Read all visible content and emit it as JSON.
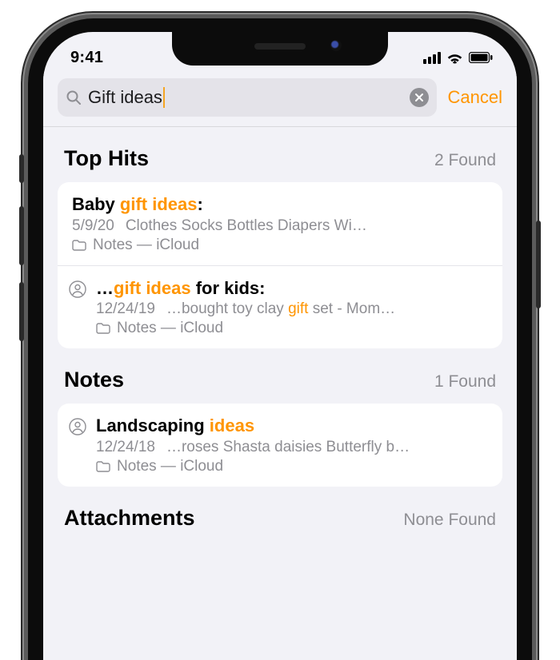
{
  "status": {
    "time": "9:41"
  },
  "search": {
    "query": "Gift ideas",
    "cancel_label": "Cancel"
  },
  "sections": {
    "top_hits": {
      "title": "Top Hits",
      "count": "2 Found",
      "results": [
        {
          "title_pre": "Baby ",
          "title_hl": "gift ideas",
          "title_post": ":",
          "date": "5/9/20",
          "snippet_pre": "Clothes Socks Bottles Diapers Wi…",
          "snippet_hl": "",
          "snippet_post": "",
          "location": "Notes — iCloud",
          "shared": false
        },
        {
          "title_pre": "…",
          "title_hl": "gift ideas",
          "title_post": " for kids:",
          "date": "12/24/19",
          "snippet_pre": "…bought toy clay ",
          "snippet_hl": "gift",
          "snippet_post": " set - Mom…",
          "location": "Notes — iCloud",
          "shared": true
        }
      ]
    },
    "notes": {
      "title": "Notes",
      "count": "1 Found",
      "results": [
        {
          "title_pre": "Landscaping ",
          "title_hl": "ideas",
          "title_post": "",
          "date": "12/24/18",
          "snippet_pre": "…roses Shasta daisies Butterfly b…",
          "snippet_hl": "",
          "snippet_post": "",
          "location": "Notes — iCloud",
          "shared": true
        }
      ]
    },
    "attachments": {
      "title": "Attachments",
      "count": "None Found"
    }
  }
}
